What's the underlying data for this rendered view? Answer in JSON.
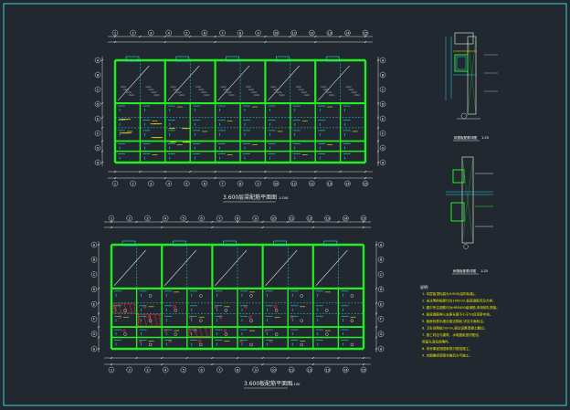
{
  "drawing": {
    "plan_top": {
      "title": "3.600层梁配筋平面图",
      "scale": "1:100"
    },
    "plan_bottom": {
      "title": "3.600板配筋平面图",
      "scale": "1:100"
    },
    "detail_1": {
      "title": "挑檐板配筋详图",
      "scale": "1:25"
    },
    "detail_2": {
      "title": "雨篷板配筋详图",
      "scale": "1:25"
    },
    "notes": {
      "heading": "说明:",
      "lines": [
        "1. 本层板顶标高为3.600(结构标高)。",
        "2. 未注明的板厚均为100mm,板底钢筋另见大样。",
        "3. 图中所注钢筋均为HRB400级钢筋,采用绑扎搭接。",
        "4. 板底钢筋伸入支座长度不小于5d且至梁中线。",
        "5. 板面负筋长度自梁边算起,详见平面标注。",
        "6. 卫生间降板50mm,周边设素混凝土翻边。",
        "7. 施工时应与建筑、水电图纸密切配合,",
        "   预留孔洞及预埋件。",
        "8. 未尽事宜按国家现行规范施工。",
        "9. 本图需经审图合格后方可施工。"
      ]
    },
    "axes": {
      "plan_top_numbers": [
        "1",
        "2",
        "3",
        "4",
        "5",
        "6",
        "7",
        "8",
        "9",
        "10",
        "11",
        "12",
        "13",
        "14",
        "15"
      ],
      "plan_top_letters": [
        "A",
        "B",
        "C",
        "D",
        "E",
        "F",
        "G",
        "H"
      ],
      "plan_bottom_numbers": [
        "1",
        "2",
        "3",
        "4",
        "5",
        "6",
        "7",
        "8",
        "9",
        "10",
        "11",
        "12",
        "13",
        "14",
        "15"
      ],
      "plan_bottom_letters": [
        "A",
        "B",
        "C",
        "D",
        "E",
        "F",
        "G",
        "H"
      ]
    },
    "colors": {
      "background": "#212830",
      "frame": "#3fd0d8",
      "beam": "#22ee22",
      "rebar": "#27d3e0",
      "dim": "#d6d6d6",
      "note": "#f2e600",
      "hatch": "#ff2a2a",
      "highlight": "#ffe600"
    }
  }
}
